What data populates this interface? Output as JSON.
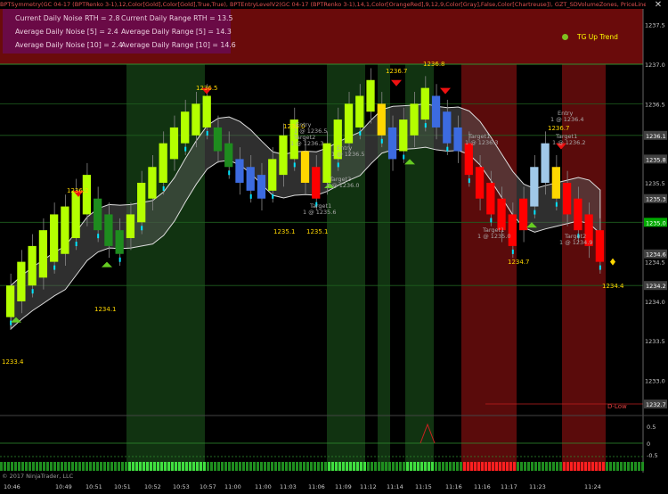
{
  "header": {
    "indicator_strip": "BPTSymmetry(GC 04-17 (BPTRenko 3-1),12,Color[Gold],Color[Gold],True,True), BPTEntryLevelV2(GC 04-17 (BPTRenko 3-1),14,1,Color[OrangeRed],9,12,9,Color[Gray],False,Color[Chartreuse]), GZT_SDVolumeZones, PriceLineWH(GC 04-17 (BPTR",
    "close_label": "✕"
  },
  "stats": {
    "noise_rth": "Current Daily Noise RTH = 2.8",
    "noise_avg5": "Average Daily Noise [5] = 2.4",
    "noise_avg10": "Average Daily Noise [10] = 2.4",
    "range_rth": "Current Daily Range RTH = 13.5",
    "range_avg5": "Average Daily Range [5] = 14.3",
    "range_avg10": "Average Daily Range [10] = 14.6"
  },
  "trend_label": "TG Up Trend",
  "copyright": "© 2017 NinjaTrader, LLC",
  "colors": {
    "up_bright": "#b4ff00",
    "up_dark": "#1e8c1e",
    "down_red": "#ff0000",
    "neutral_blue": "#3c6be0",
    "light_blue": "#a0c8e8",
    "gold": "#ffd700",
    "cyan": "#00e5ff",
    "green_zone": "#113311",
    "red_zone": "#5a0b0b"
  },
  "chart_data": {
    "type": "candlestick-renko",
    "y_axis_labels": [
      "1237.5",
      "1237.0",
      "1236.5",
      "1236.1",
      "1235.5",
      "1235.3",
      "1235.0",
      "1234.6",
      "1234.5",
      "1234.2",
      "1234.0",
      "1233.5",
      "1233.0",
      "1232.7"
    ],
    "price_tags": [
      {
        "text": "1236.1",
        "color": "#404040"
      },
      {
        "text": "1235.8",
        "color": "#404040"
      },
      {
        "text": "1235.3",
        "color": "#404040"
      },
      {
        "text": "1235.0",
        "color": "#00aa00"
      },
      {
        "text": "1234.6",
        "color": "#404040"
      },
      {
        "text": "1234.2",
        "color": "#404040"
      },
      {
        "text": "1232.7",
        "color": "#404040"
      }
    ],
    "osc_axis_labels": [
      "0.5",
      "0",
      "-0.5"
    ],
    "x_labels": [
      "10:46",
      "10:49",
      "10:51",
      "10:51",
      "10:52",
      "10:53",
      "10:57",
      "11:00",
      "11:00",
      "11:03",
      "11:06",
      "11:09",
      "11:12",
      "11:14",
      "11:15",
      "11:16",
      "11:16",
      "11:17",
      "11:23",
      "11:24"
    ],
    "price_annotations": [
      "1233.4",
      "1236.2",
      "1234.1",
      "1236.5",
      "1236.7",
      "1236.0",
      "1236.8",
      "1235.1",
      "1235.1",
      "1234.7",
      "1234.4",
      "1236.7"
    ],
    "order_annotations": [
      "Entry",
      "1 @ 1236.5",
      "Target2",
      "1 @ 1236.3",
      "Target1",
      "1 @ 1235.6",
      "Entry",
      "1 @ 1236.5",
      "Target2",
      "1 @ 1236.0",
      "Target1",
      "1 @ 1236.3",
      "Entry",
      "1 @ 1236.4",
      "Target1",
      "1 @ 1236.2",
      "Target2",
      "1 @ 1234.9",
      "Target1",
      "1 @ 1235.0"
    ],
    "d_low_label": "D-Low",
    "renko": [
      {
        "o": 1233.8,
        "c": 1234.2,
        "col": "up"
      },
      {
        "o": 1234.0,
        "c": 1234.5,
        "col": "up"
      },
      {
        "o": 1234.2,
        "c": 1234.7,
        "col": "up"
      },
      {
        "o": 1234.3,
        "c": 1234.9,
        "col": "up"
      },
      {
        "o": 1234.5,
        "c": 1235.1,
        "col": "up"
      },
      {
        "o": 1234.6,
        "c": 1235.2,
        "col": "up"
      },
      {
        "o": 1234.8,
        "c": 1235.4,
        "col": "up"
      },
      {
        "o": 1235.1,
        "c": 1235.6,
        "col": "up"
      },
      {
        "o": 1234.9,
        "c": 1235.3,
        "col": "dup"
      },
      {
        "o": 1234.7,
        "c": 1235.1,
        "col": "dup"
      },
      {
        "o": 1234.6,
        "c": 1234.9,
        "col": "dup"
      },
      {
        "o": 1234.8,
        "c": 1235.1,
        "col": "up"
      },
      {
        "o": 1235.0,
        "c": 1235.5,
        "col": "up"
      },
      {
        "o": 1235.3,
        "c": 1235.7,
        "col": "up"
      },
      {
        "o": 1235.5,
        "c": 1236.0,
        "col": "up"
      },
      {
        "o": 1235.8,
        "c": 1236.2,
        "col": "up"
      },
      {
        "o": 1236.0,
        "c": 1236.4,
        "col": "up"
      },
      {
        "o": 1236.1,
        "c": 1236.5,
        "col": "up"
      },
      {
        "o": 1236.2,
        "c": 1236.6,
        "col": "up"
      },
      {
        "o": 1235.9,
        "c": 1236.2,
        "col": "dup"
      },
      {
        "o": 1235.7,
        "c": 1236.0,
        "col": "dup"
      },
      {
        "o": 1235.5,
        "c": 1235.8,
        "col": "blue"
      },
      {
        "o": 1235.4,
        "c": 1235.7,
        "col": "blue"
      },
      {
        "o": 1235.3,
        "c": 1235.6,
        "col": "blue"
      },
      {
        "o": 1235.4,
        "c": 1235.8,
        "col": "up"
      },
      {
        "o": 1235.6,
        "c": 1236.1,
        "col": "up"
      },
      {
        "o": 1235.8,
        "c": 1236.3,
        "col": "up"
      },
      {
        "o": 1235.5,
        "c": 1235.9,
        "col": "gold"
      },
      {
        "o": 1235.3,
        "c": 1235.7,
        "col": "red"
      },
      {
        "o": 1235.5,
        "c": 1236.0,
        "col": "up"
      },
      {
        "o": 1235.8,
        "c": 1236.3,
        "col": "up"
      },
      {
        "o": 1236.0,
        "c": 1236.5,
        "col": "up"
      },
      {
        "o": 1236.2,
        "c": 1236.6,
        "col": "up"
      },
      {
        "o": 1236.4,
        "c": 1236.8,
        "col": "up"
      },
      {
        "o": 1236.1,
        "c": 1236.5,
        "col": "gold"
      },
      {
        "o": 1235.8,
        "c": 1236.2,
        "col": "blue"
      },
      {
        "o": 1235.9,
        "c": 1236.3,
        "col": "up"
      },
      {
        "o": 1236.1,
        "c": 1236.5,
        "col": "up"
      },
      {
        "o": 1236.3,
        "c": 1236.7,
        "col": "up"
      },
      {
        "o": 1236.2,
        "c": 1236.6,
        "col": "blue"
      },
      {
        "o": 1236.0,
        "c": 1236.4,
        "col": "blue"
      },
      {
        "o": 1235.9,
        "c": 1236.2,
        "col": "blue"
      },
      {
        "o": 1235.6,
        "c": 1236.0,
        "col": "red"
      },
      {
        "o": 1235.3,
        "c": 1235.7,
        "col": "red"
      },
      {
        "o": 1235.1,
        "c": 1235.5,
        "col": "red"
      },
      {
        "o": 1234.9,
        "c": 1235.3,
        "col": "red"
      },
      {
        "o": 1234.7,
        "c": 1235.1,
        "col": "red"
      },
      {
        "o": 1234.9,
        "c": 1235.3,
        "col": "red"
      },
      {
        "o": 1235.2,
        "c": 1235.7,
        "col": "lblue"
      },
      {
        "o": 1235.5,
        "c": 1236.0,
        "col": "lblue"
      },
      {
        "o": 1235.3,
        "c": 1235.7,
        "col": "gold"
      },
      {
        "o": 1235.1,
        "c": 1235.5,
        "col": "red"
      },
      {
        "o": 1234.9,
        "c": 1235.3,
        "col": "red"
      },
      {
        "o": 1234.7,
        "c": 1235.1,
        "col": "red"
      },
      {
        "o": 1234.5,
        "c": 1234.9,
        "col": "red"
      }
    ],
    "ylim": [
      1232.6,
      1237.7
    ]
  }
}
